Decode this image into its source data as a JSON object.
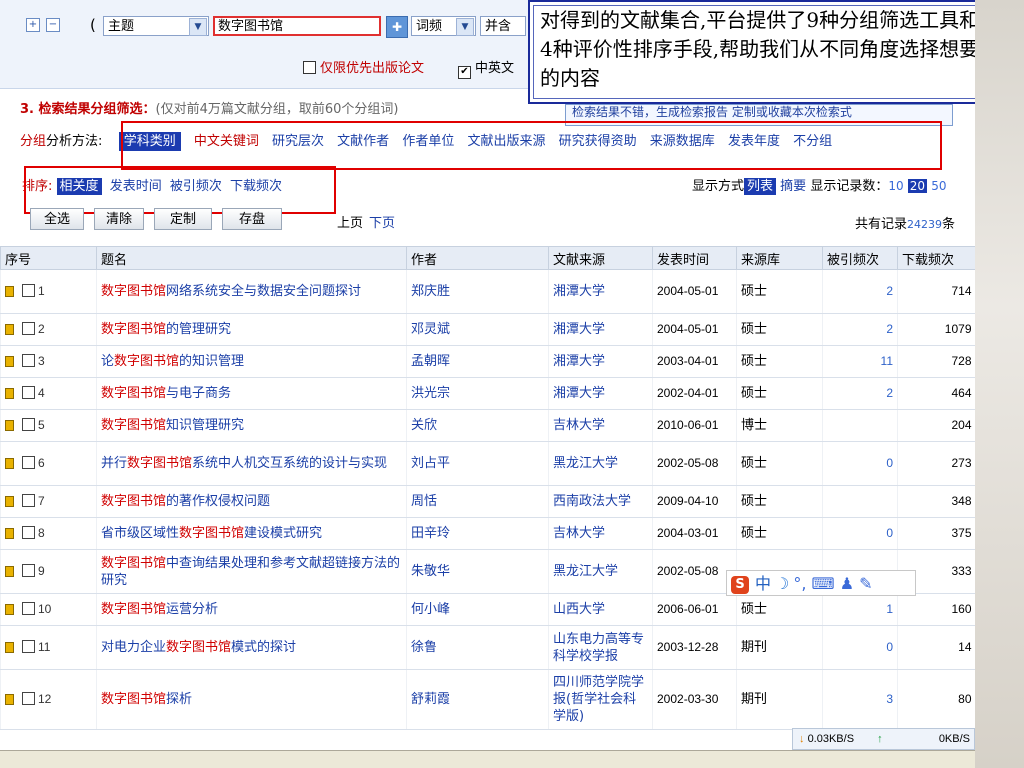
{
  "search": {
    "field_select": "主题",
    "keyword": "数字图书馆",
    "freq_select": "词频",
    "combine_select": "并含",
    "option_priority": "仅限优先出版论文",
    "option_lang": "中英文"
  },
  "callout": {
    "text": "对得到的文献集合,平台提供了9种分组筛选工具和4种评价性排序手段,帮助我们从不同角度选择想要的内容"
  },
  "section3": {
    "title": "3. 检索结果分组筛选：",
    "note": "(仅对前4万篇文献分组，取前60个分组词)",
    "links": "检索结果不错，生成检索报告    定制或收藏本次检索式"
  },
  "grouping": {
    "label_red": "分组",
    "label_rest": "分析方法:",
    "active": "学科类别",
    "items": [
      "中文关键词",
      "研究层次",
      "文献作者",
      "作者单位",
      "文献出版来源",
      "研究获得资助",
      "来源数据库",
      "发表年度",
      "不分组"
    ]
  },
  "sorting": {
    "label": "排序:",
    "active": "相关度",
    "items": [
      "发表时间",
      "被引频次",
      "下载频次"
    ]
  },
  "display": {
    "label": "显示方式",
    "mode_active": "列表",
    "mode_other": "摘要",
    "count_label": "显示记录数：",
    "count_10": "10",
    "count_20": "20",
    "count_50": "50"
  },
  "toolbar": {
    "select_all": "全选",
    "clear": "清除",
    "customize": "定制",
    "save": "存盘",
    "prev": "上页",
    "next": "下页",
    "total_prefix": "共有记录",
    "total_count": "24239",
    "total_suffix": "条"
  },
  "table": {
    "headers": [
      "序号",
      "题名",
      "作者",
      "文献来源",
      "发表时间",
      "来源库",
      "被引频次",
      "下载频次"
    ],
    "rows": [
      {
        "no": "1",
        "title_hl": "数字图书馆",
        "title_rest": "网络系统安全与数据安全问题探讨",
        "author": "郑庆胜",
        "source": "湘潭大学",
        "date": "2004-05-01",
        "db": "硕士",
        "cited": "2",
        "downloads": "714"
      },
      {
        "no": "2",
        "title_hl": "数字图书馆",
        "title_rest": "的管理研究",
        "author": "邓灵斌",
        "source": "湘潭大学",
        "date": "2004-05-01",
        "db": "硕士",
        "cited": "2",
        "downloads": "1079"
      },
      {
        "no": "3",
        "title_pre": "论",
        "title_hl": "数字图书馆",
        "title_rest": "的知识管理",
        "author": "孟朝晖",
        "source": "湘潭大学",
        "date": "2003-04-01",
        "db": "硕士",
        "cited": "11",
        "downloads": "728"
      },
      {
        "no": "4",
        "title_hl": "数字图书馆",
        "title_rest": "与电子商务",
        "author": "洪光宗",
        "source": "湘潭大学",
        "date": "2002-04-01",
        "db": "硕士",
        "cited": "2",
        "downloads": "464"
      },
      {
        "no": "5",
        "title_hl": "数字图书馆",
        "title_rest": "知识管理研究",
        "author": "关欣",
        "source": "吉林大学",
        "date": "2010-06-01",
        "db": "博士",
        "cited": "",
        "downloads": "204"
      },
      {
        "no": "6",
        "title_pre": "并行",
        "title_hl": "数字图书馆",
        "title_rest": "系统中人机交互系统的设计与实现",
        "author": "刘占平",
        "source": "黑龙江大学",
        "date": "2002-05-08",
        "db": "硕士",
        "cited": "0",
        "downloads": "273"
      },
      {
        "no": "7",
        "title_hl": "数字图书馆",
        "title_rest": "的著作权侵权问题",
        "author": "周恬",
        "source": "西南政法大学",
        "date": "2009-04-10",
        "db": "硕士",
        "cited": "",
        "downloads": "348"
      },
      {
        "no": "8",
        "title_pre": "省市级区域性",
        "title_hl": "数字图书馆",
        "title_rest": "建设模式研究",
        "author": "田辛玲",
        "source": "吉林大学",
        "date": "2004-03-01",
        "db": "硕士",
        "cited": "0",
        "downloads": "375"
      },
      {
        "no": "9",
        "title_hl": "数字图书馆",
        "title_rest": "中查询结果处理和参考文献超链接方法的研究",
        "author": "朱敬华",
        "source": "黑龙江大学",
        "date": "2002-05-08",
        "db": "",
        "cited": "",
        "downloads": "333"
      },
      {
        "no": "10",
        "title_hl": "数字图书馆",
        "title_rest": "运营分析",
        "author": "何小峰",
        "source": "山西大学",
        "date": "2006-06-01",
        "db": "硕士",
        "cited": "1",
        "downloads": "160"
      },
      {
        "no": "11",
        "title_pre": "对电力企业",
        "title_hl": "数字图书馆",
        "title_rest": "模式的探讨",
        "author": "徐鲁",
        "source": "山东电力高等专科学校学报",
        "date": "2003-12-28",
        "db": "期刊",
        "cited": "0",
        "downloads": "14"
      },
      {
        "no": "12",
        "title_hl": "数字图书馆",
        "title_rest": "探析",
        "author": "舒莉霞",
        "source": "四川师范学院学报(哲学社会科学版)",
        "date": "2002-03-30",
        "db": "期刊",
        "cited": "3",
        "downloads": "80"
      }
    ]
  },
  "ime": {
    "logo": "S",
    "lang": "中",
    "moon": "☽",
    "rest": "°, ⌨ ♟ ✎"
  },
  "net": {
    "down": "0.03KB/S",
    "up": "0KB/S"
  }
}
